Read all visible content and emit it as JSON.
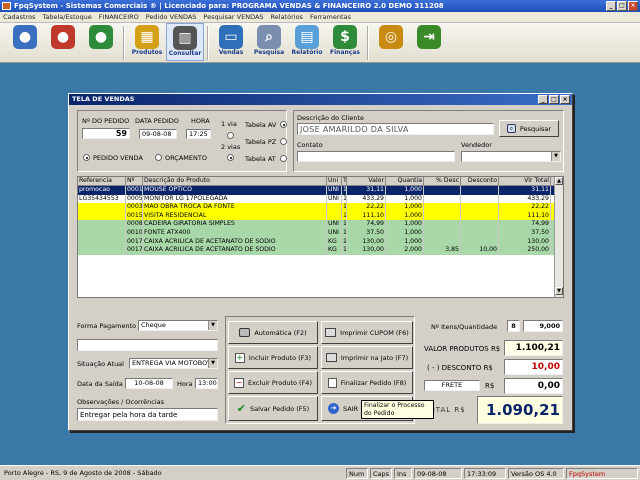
{
  "window": {
    "title": "FpqSystem - Sistemas Comerciais ® | Licenciado para: PROGRAMA VENDAS & FINANCEIRO 2.0 DEMO 311208"
  },
  "menu": [
    "Cadastros",
    "Tabela/Estoque",
    "FINANCEIRO",
    "Pedido VENDAS",
    "Pesquisar VENDAS",
    "Relatórios",
    "Ferramentas"
  ],
  "toolbar": [
    {
      "name": "user-1-button",
      "icon": "person-icon",
      "label": "",
      "color": "#3a6fc0"
    },
    {
      "name": "user-2-button",
      "icon": "person-icon",
      "label": "",
      "color": "#c0392b"
    },
    {
      "name": "user-3-button",
      "icon": "person-icon",
      "label": "",
      "color": "#2e8b3a"
    },
    {
      "name": "produtos-button",
      "icon": "boxes-icon",
      "label": "Produtos",
      "color": "#d4a017"
    },
    {
      "name": "consultar-button",
      "icon": "barcode-icon",
      "label": "Consultar",
      "color": "#555555"
    },
    {
      "name": "vendas-button",
      "icon": "monitor-icon",
      "label": "Vendas",
      "color": "#2d6fb8"
    },
    {
      "name": "pesquisa-button",
      "icon": "magnifier-icon",
      "label": "Pesquisa",
      "color": "#7a8fb0"
    },
    {
      "name": "relatorio-button",
      "icon": "printer-icon",
      "label": "Relatório",
      "color": "#5aa0d8"
    },
    {
      "name": "financas-button",
      "icon": "money-icon",
      "label": "Finanças",
      "color": "#2e8b3a"
    },
    {
      "name": "coin-button",
      "icon": "coin-icon",
      "label": "",
      "color": "#c88a10"
    },
    {
      "name": "exit-button",
      "icon": "exit-icon",
      "label": "",
      "color": "#3a8a2a"
    }
  ],
  "dialog": {
    "title": "TELA DE VENDAS",
    "pedido": {
      "num_label": "Nº DO PEDIDO",
      "num_value": "59",
      "data_label": "DATA PEDIDO",
      "data_value": "09-08-08",
      "hora_label": "HORA",
      "hora_value": "17:25",
      "via1": "1 via",
      "via2": "2 vias",
      "tabela_av": "Tabela AV",
      "tabela_pz": "Tabela PZ",
      "tabela_at": "Tabela AT",
      "pedido_venda": "PEDIDO VENDA",
      "orcamento": "ORÇAMENTO"
    },
    "cliente": {
      "desc_label": "Descrição do Cliente",
      "desc_value": "JOSE AMARILDO DA SILVA",
      "pesquisar": "Pesquisar",
      "contato_label": "Contato",
      "contato_value": "",
      "vendedor_label": "Vendedor",
      "vendedor_value": ""
    },
    "grid": {
      "headers": [
        "Referencia",
        "Nº",
        "Descrição do Produto",
        "Uni",
        "T",
        "Valor",
        "Quantia",
        "% Desc",
        "Desconto",
        "Vlr Total"
      ],
      "rows": [
        {
          "bg": "#0a246a",
          "fg": "#ffffff",
          "cells": [
            "promocao",
            "0001",
            "MOUSE OPTICO",
            "UNI",
            "1",
            "31,11",
            "1,000",
            "",
            "",
            "31,11"
          ]
        },
        {
          "bg": "#ffffff",
          "fg": "#000000",
          "cells": [
            "LG35434553",
            "0005",
            "MONITOR LG 17POLEGADA",
            "UNI",
            "1",
            "433,29",
            "1,000",
            "",
            "",
            "433,29"
          ]
        },
        {
          "bg": "#ffff00",
          "fg": "#000000",
          "cells": [
            "",
            "0003",
            "MÃO OBRA TROCA DA FONTE",
            "",
            "1",
            "22,22",
            "1,000",
            "",
            "",
            "22,22"
          ]
        },
        {
          "bg": "#ffff00",
          "fg": "#000000",
          "cells": [
            "",
            "0015",
            "VISITA RESIDENCIAL",
            "",
            "1",
            "111,10",
            "1,000",
            "",
            "",
            "111,10"
          ]
        },
        {
          "bg": "#a8d8a8",
          "fg": "#000000",
          "cells": [
            "",
            "0008",
            "CADEIRA GIRATORIA SIMPLES",
            "UNI",
            "1",
            "74,99",
            "1,000",
            "",
            "",
            "74,99"
          ]
        },
        {
          "bg": "#a8d8a8",
          "fg": "#000000",
          "cells": [
            "",
            "0010",
            "FONTE ATX400",
            "UNI",
            "1",
            "37,50",
            "1,000",
            "",
            "",
            "37,50"
          ]
        },
        {
          "bg": "#a8d8a8",
          "fg": "#000000",
          "cells": [
            "",
            "0017",
            "CAIXA ACRILICA DE ACETANATO DE SODIO",
            "KG",
            "1",
            "130,00",
            "1,000",
            "",
            "",
            "130,00"
          ]
        },
        {
          "bg": "#a8d8a8",
          "fg": "#000000",
          "cells": [
            "",
            "0017",
            "CAIXA ACRILICA DE ACETANATO DE SODIO",
            "KG",
            "1",
            "130,00",
            "2,000",
            "3,85",
            "10,00",
            "250,00"
          ]
        }
      ]
    },
    "pagamento": {
      "forma_label": "Forma Pagamento",
      "forma_value": "Cheque",
      "situacao_label": "Situação Atual",
      "situacao_value": "ENTREGA VIA MOTOBOY",
      "saida_label": "Data da Saída",
      "saida_value": "10-08-08",
      "hora_label": "Hora",
      "hora_value": "13:00",
      "obs_label": "Observações / Ocorrências",
      "obs_value": "Entregar pela hora da tarde"
    },
    "actions": {
      "automatica": "Automática   (F2)",
      "incluir": "Incluir Produto (F3)",
      "excluir": "Excluir Produto (F4)",
      "salvar": "Salvar Pedido  (F5)",
      "cupom": "Imprimir CUPOM  (F6)",
      "jato": "Imprimir na Jato  (F7)",
      "finalizar": "Finalizar Pedido  (F8)",
      "sair": "SAIR",
      "tooltip": "Finalizar o Processo do Pedido"
    },
    "totais": {
      "itens_label": "Nº Itens/Quantidade",
      "itens_value": "8",
      "qtd_value": "9,000",
      "produtos_label": "VALOR PRODUTOS R$",
      "produtos_value": "1.100,21",
      "desconto_label": "( - ) DESCONTO R$",
      "desconto_value": "10,00",
      "frete_label": "FRETE",
      "frete_currency": "R$",
      "frete_value": "0,00",
      "total_label": "TOTAL R$",
      "total_value": "1.090,21"
    }
  },
  "status": {
    "location": "Porto Alegre - RS,  9 de Agosto de 2008 - Sábado",
    "num": "Num",
    "caps": "Caps",
    "ins": "Ins",
    "date": "09-08-08",
    "time": "17:33:09",
    "version": "Versão OS 4.0",
    "brand": "FpqSystem"
  },
  "colors": {
    "desktop": "#3a78a8",
    "titlebar": "#1f4fb8",
    "selected_row": "#0a246a",
    "yellow_row": "#ffff00",
    "green_row": "#a8d8a8",
    "desconto_text": "#c00000",
    "total_bg": "#ffffe0"
  }
}
